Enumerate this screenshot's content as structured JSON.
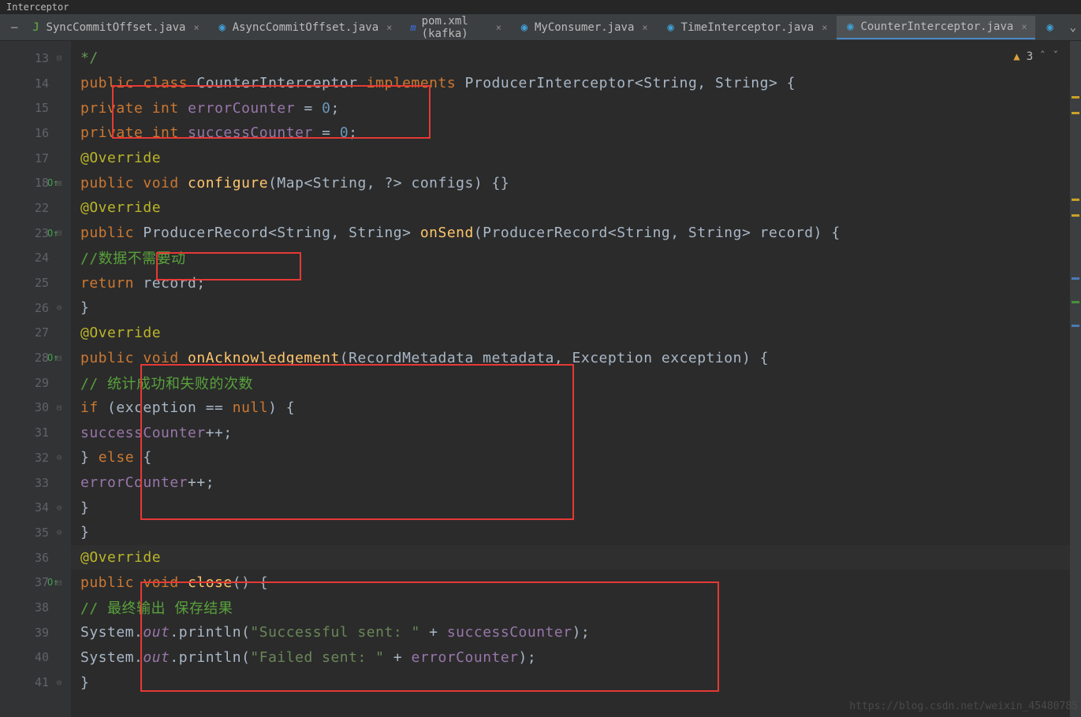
{
  "window": {
    "title_fragment": "Interceptor"
  },
  "tabs": [
    {
      "label": "SyncCommitOffset.java",
      "active": false,
      "ico": "j1"
    },
    {
      "label": "AsyncCommitOffset.java",
      "active": false,
      "ico": "c"
    },
    {
      "label": "pom.xml (kafka)",
      "active": false,
      "ico": "m"
    },
    {
      "label": "MyConsumer.java",
      "active": false,
      "ico": "c"
    },
    {
      "label": "TimeInterceptor.java",
      "active": false,
      "ico": "c"
    },
    {
      "label": "CounterInterceptor.java",
      "active": true,
      "ico": "c"
    }
  ],
  "inspection": {
    "warn_count": "3"
  },
  "gutter": [
    "13",
    "14",
    "15",
    "16",
    "17",
    "18",
    "22",
    "23",
    "24",
    "25",
    "26",
    "27",
    "28",
    "29",
    "30",
    "31",
    "32",
    "33",
    "34",
    "35",
    "36",
    "37",
    "38",
    "39",
    "40",
    "41"
  ],
  "code": {
    "l13": "*/",
    "l14_a": "public ",
    "l14_b": "class ",
    "l14_c": "CounterInterceptor ",
    "l14_d": "implements ",
    "l14_e": "ProducerInterceptor<String, String> {",
    "l15_a": "private ",
    "l15_b": "int ",
    "l15_c": "errorCounter ",
    "l15_d": "= ",
    "l15_e": "0",
    "l15_f": ";",
    "l16_a": "private ",
    "l16_b": "int ",
    "l16_c": "successCounter ",
    "l16_d": "= ",
    "l16_e": "0",
    "l16_f": ";",
    "l17": "@Override",
    "l18_a": "public ",
    "l18_b": "void ",
    "l18_c": "configure",
    "l18_d": "(Map<String, ?> configs) {}",
    "l22": "@Override",
    "l23_a": "public ",
    "l23_b": "ProducerRecord<String, String> ",
    "l23_c": "onSend",
    "l23_d": "(ProducerRecord<String, String> record) {",
    "l24": "//数据不需要动",
    "l25_a": "return ",
    "l25_b": "record;",
    "l26": "}",
    "l27": "@Override",
    "l28_a": "public ",
    "l28_b": "void ",
    "l28_c": "onAcknowledgement",
    "l28_d": "(RecordMetadata metadata, Exception exception) {",
    "l29": "// 统计成功和失败的次数",
    "l30_a": "if ",
    "l30_b": "(exception == ",
    "l30_c": "null",
    "l30_d": ") {",
    "l31_a": "successCounter",
    "l31_b": "++;",
    "l32_a": "} ",
    "l32_b": "else ",
    "l32_c": "{",
    "l33_a": "errorCounter",
    "l33_b": "++;",
    "l34": "}",
    "l35": "}",
    "l36": "@Override",
    "l37_a": "public ",
    "l37_b": "void ",
    "l37_c": "close",
    "l37_d": "() {",
    "l38": "// 最终输出 保存结果",
    "l39_a": "System.",
    "l39_b": "out",
    "l39_c": ".println(",
    "l39_d": "\"Successful sent: \"",
    "l39_e": " + ",
    "l39_f": "successCounter",
    "l39_g": ");",
    "l40_a": "System.",
    "l40_b": "out",
    "l40_c": ".println(",
    "l40_d": "\"Failed sent: \"",
    "l40_e": " + ",
    "l40_f": "errorCounter",
    "l40_g": ");",
    "l41": "}"
  },
  "footer": {
    "url": "https://blog.csdn.net/weixin_45480785"
  }
}
